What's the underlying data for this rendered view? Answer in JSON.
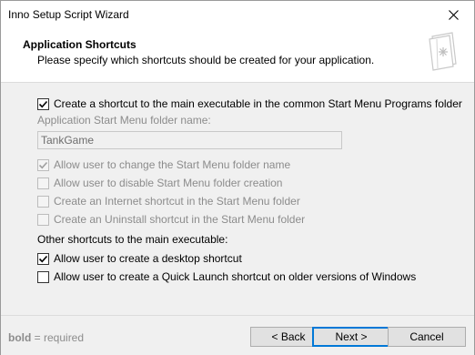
{
  "window": {
    "title": "Inno Setup Script Wizard"
  },
  "header": {
    "title": "Application Shortcuts",
    "subtitle": "Please specify which shortcuts should be created for your application.",
    "icon": "wizard-page-icon"
  },
  "options": {
    "main_shortcut": {
      "label": "Create a shortcut to the main executable in the common Start Menu Programs folder",
      "checked": true,
      "enabled": true
    },
    "folder_name_label": "Application Start Menu folder name:",
    "folder_name_value": "TankGame",
    "allow_change_folder": {
      "label": "Allow user to change the Start Menu folder name",
      "checked": true,
      "enabled": false
    },
    "allow_disable_folder": {
      "label": "Allow user to disable Start Menu folder creation",
      "checked": false,
      "enabled": false
    },
    "internet_shortcut": {
      "label": "Create an Internet shortcut in the Start Menu folder",
      "checked": false,
      "enabled": false
    },
    "uninstall_shortcut": {
      "label": "Create an Uninstall shortcut in the Start Menu folder",
      "checked": false,
      "enabled": false
    },
    "other_label": "Other shortcuts to the main executable:",
    "desktop_shortcut": {
      "label": "Allow user to create a desktop shortcut",
      "checked": true,
      "enabled": true
    },
    "quicklaunch_shortcut": {
      "label": "Allow user to create a Quick Launch shortcut on older versions of Windows",
      "checked": false,
      "enabled": true
    }
  },
  "footer": {
    "note_bold": "bold",
    "note_rest": " = required",
    "back_label": "< Back",
    "next_label": "Next >",
    "cancel_label": "Cancel"
  },
  "colors": {
    "accent": "#0078d7",
    "disabled_text": "#8c8c8c"
  }
}
